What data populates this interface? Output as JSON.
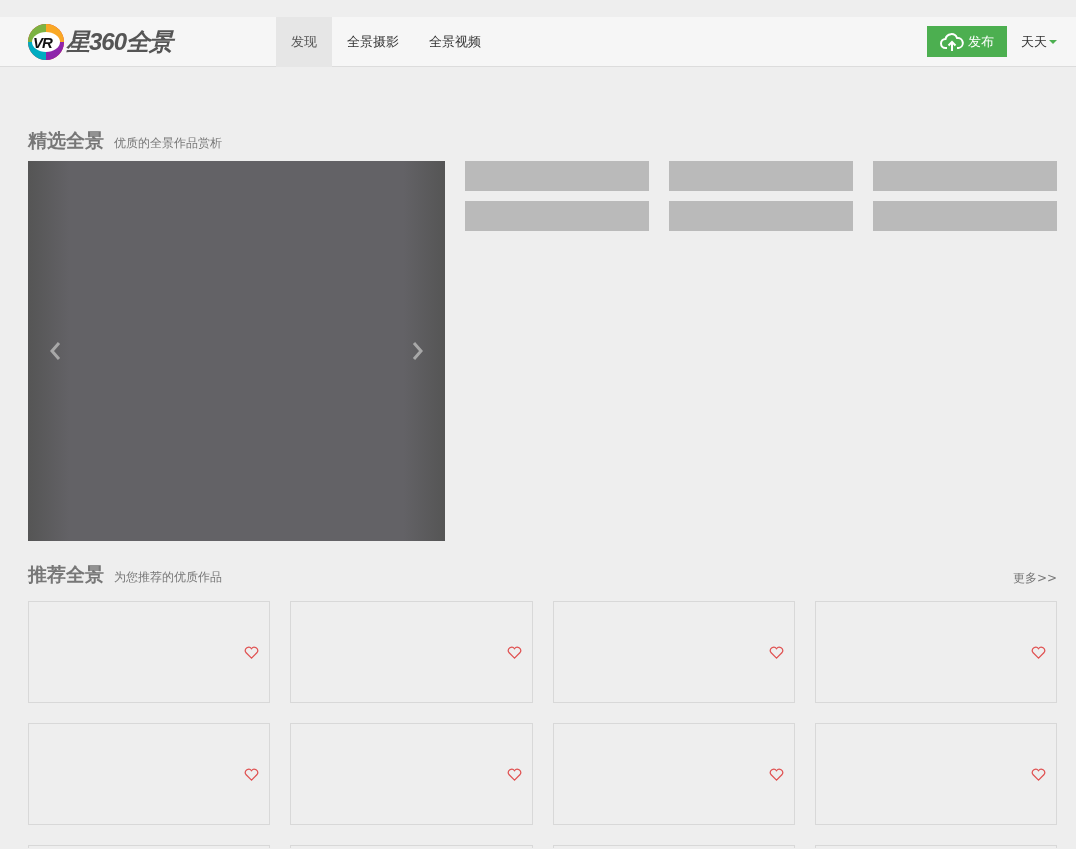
{
  "header": {
    "logo_badge": "VR",
    "logo_text": "星360全景",
    "nav": [
      {
        "label": "发现",
        "selected": true
      },
      {
        "label": "全景摄影",
        "selected": false
      },
      {
        "label": "全景视频",
        "selected": false
      }
    ],
    "publish_button": "发布",
    "user": "天天"
  },
  "featured": {
    "title": "精选全景",
    "subtitle": "优质的全景作品赏析",
    "thumbnails": [
      {
        "kind": "placeholder"
      },
      {
        "kind": "placeholder"
      },
      {
        "kind": "placeholder"
      },
      {
        "kind": "placeholder"
      },
      {
        "kind": "placeholder"
      },
      {
        "kind": "placeholder"
      }
    ]
  },
  "recommended": {
    "title": "推荐全景",
    "subtitle": "为您推荐的优质作品",
    "more_link": "更多>>",
    "cards": [
      {
        "kind": "work"
      },
      {
        "kind": "work"
      },
      {
        "kind": "work"
      },
      {
        "kind": "work"
      },
      {
        "kind": "work"
      },
      {
        "kind": "work"
      },
      {
        "kind": "work"
      },
      {
        "kind": "work"
      },
      {
        "kind": "work"
      },
      {
        "kind": "work"
      },
      {
        "kind": "work"
      },
      {
        "kind": "work"
      }
    ]
  }
}
